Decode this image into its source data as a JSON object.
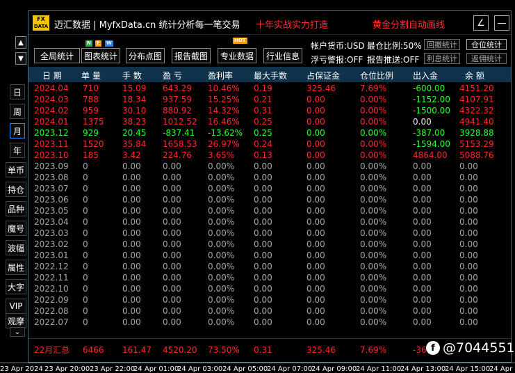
{
  "side": {
    "arrows": [
      "▲",
      "▼"
    ],
    "periods": [
      {
        "label": "日",
        "active": false
      },
      {
        "label": "周",
        "active": false
      },
      {
        "label": "月",
        "active": true
      },
      {
        "label": "年",
        "active": false
      }
    ],
    "functions": [
      "单币",
      "持仓",
      "品种",
      "魔号",
      "波幅",
      "属性",
      "大字",
      "VIP",
      "观摩"
    ],
    "more": "⌄"
  },
  "titlebar": {
    "logo_top": "FX",
    "logo_bottom": "DATA",
    "title": "迈汇数据 | MyfxData.cn  统计分析每一笔交易",
    "slogan1": "十年实战实力打造",
    "slogan2": "黄金分割自动画线",
    "btn_draw": "∠",
    "btn_min": "—"
  },
  "toolbar": {
    "buttons": [
      "全局统计",
      "图表统计",
      "分布点图",
      "报告截图",
      "专业数据",
      "行业信息"
    ],
    "badges": {
      "n": "N",
      "e": "E",
      "w": "W",
      "hot": "HOT"
    },
    "account_currency": "帐户货币:USD",
    "floating_alert": "浮亏警报:OFF",
    "max_ratio": "最仓比例:50%",
    "report_push": "报告推送:OFF",
    "retrace_btn": "回撤统计",
    "interest_btn": "利息统计",
    "position_btn": "仓位统计",
    "commission_btn": "返佣统计"
  },
  "table": {
    "headers": [
      "日 期",
      "单 量",
      "手 数",
      "盈 亏",
      "盈利率",
      "最大手数",
      "占保证金",
      "仓位比例",
      "出入金",
      "余 额"
    ],
    "rows": [
      {
        "color": "red",
        "cells": [
          "2024.04",
          "710",
          "15.09",
          "643.29",
          "10.46%",
          "0.19",
          "325.46",
          "7.69%",
          "-600.00",
          "4151.20"
        ],
        "flow": "green"
      },
      {
        "color": "red",
        "cells": [
          "2024.03",
          "788",
          "18.34",
          "937.59",
          "15.25%",
          "0.21",
          "0.00",
          "0.00%",
          "-1152.00",
          "4107.91"
        ],
        "flow": "green"
      },
      {
        "color": "red",
        "cells": [
          "2024.02",
          "959",
          "30.10",
          "880.92",
          "14.32%",
          "0.31",
          "0.00",
          "0.00%",
          "-1500.00",
          "4322.32"
        ],
        "flow": "green"
      },
      {
        "color": "red",
        "cells": [
          "2024.01",
          "1375",
          "38.23",
          "1012.52",
          "16.46%",
          "0.25",
          "0.00",
          "0.00%",
          "0.00",
          "4941.40"
        ],
        "flow": "white"
      },
      {
        "color": "green",
        "cells": [
          "2023.12",
          "929",
          "20.45",
          "-837.41",
          "-13.62%",
          "0.25",
          "0.00",
          "0.00%",
          "-387.00",
          "3928.88"
        ],
        "flow": "green"
      },
      {
        "color": "red",
        "cells": [
          "2023.11",
          "1520",
          "35.84",
          "1658.53",
          "26.97%",
          "0.24",
          "0.00",
          "0.00%",
          "-1594.00",
          "5153.29"
        ],
        "flow": "green"
      },
      {
        "color": "red",
        "cells": [
          "2023.10",
          "185",
          "3.42",
          "224.76",
          "3.65%",
          "0.13",
          "0.00",
          "0.00%",
          "4864.00",
          "5088.76"
        ],
        "flow": "red"
      },
      {
        "color": "gray",
        "cells": [
          "2023.09",
          "0",
          "0.00",
          "0.00",
          "0.00%",
          "0.00",
          "0.00",
          "0.00%",
          "0.00",
          "0.00"
        ],
        "flow": "gray"
      },
      {
        "color": "gray",
        "cells": [
          "2023.08",
          "0",
          "0.00",
          "0.00",
          "0.00%",
          "0.00",
          "0.00",
          "0.00%",
          "0.00",
          "0.00"
        ],
        "flow": "gray"
      },
      {
        "color": "gray",
        "cells": [
          "2023.07",
          "0",
          "0.00",
          "0.00",
          "0.00%",
          "0.00",
          "0.00",
          "0.00%",
          "0.00",
          "0.00"
        ],
        "flow": "gray"
      },
      {
        "color": "gray",
        "cells": [
          "2023.06",
          "0",
          "0.00",
          "0.00",
          "0.00%",
          "0.00",
          "0.00",
          "0.00%",
          "0.00",
          "0.00"
        ],
        "flow": "gray"
      },
      {
        "color": "gray",
        "cells": [
          "2023.05",
          "0",
          "0.00",
          "0.00",
          "0.00%",
          "0.00",
          "0.00",
          "0.00%",
          "0.00",
          "0.00"
        ],
        "flow": "gray"
      },
      {
        "color": "gray",
        "cells": [
          "2023.04",
          "0",
          "0.00",
          "0.00",
          "0.00%",
          "0.00",
          "0.00",
          "0.00%",
          "0.00",
          "0.00"
        ],
        "flow": "gray"
      },
      {
        "color": "gray",
        "cells": [
          "2023.03",
          "0",
          "0.00",
          "0.00",
          "0.00%",
          "0.00",
          "0.00",
          "0.00%",
          "0.00",
          "0.00"
        ],
        "flow": "gray"
      },
      {
        "color": "gray",
        "cells": [
          "2023.02",
          "0",
          "0.00",
          "0.00",
          "0.00%",
          "0.00",
          "0.00",
          "0.00%",
          "0.00",
          "0.00"
        ],
        "flow": "gray"
      },
      {
        "color": "gray",
        "cells": [
          "2023.01",
          "0",
          "0.00",
          "0.00",
          "0.00%",
          "0.00",
          "0.00",
          "0.00%",
          "0.00",
          "0.00"
        ],
        "flow": "gray"
      },
      {
        "color": "gray",
        "cells": [
          "2022.12",
          "0",
          "0.00",
          "0.00",
          "0.00%",
          "0.00",
          "0.00",
          "0.00%",
          "0.00",
          "0.00"
        ],
        "flow": "gray"
      },
      {
        "color": "gray",
        "cells": [
          "2022.11",
          "0",
          "0.00",
          "0.00",
          "0.00%",
          "0.00",
          "0.00",
          "0.00%",
          "0.00",
          "0.00"
        ],
        "flow": "gray"
      },
      {
        "color": "gray",
        "cells": [
          "2022.10",
          "0",
          "0.00",
          "0.00",
          "0.00%",
          "0.00",
          "0.00",
          "0.00%",
          "0.00",
          "0.00"
        ],
        "flow": "gray"
      },
      {
        "color": "gray",
        "cells": [
          "2022.09",
          "0",
          "0.00",
          "0.00",
          "0.00%",
          "0.00",
          "0.00",
          "0.00%",
          "0.00",
          "0.00"
        ],
        "flow": "gray"
      },
      {
        "color": "gray",
        "cells": [
          "2022.08",
          "0",
          "0.00",
          "0.00",
          "0.00%",
          "0.00",
          "0.00",
          "0.00%",
          "0.00",
          "0.00"
        ],
        "flow": "gray"
      },
      {
        "color": "gray",
        "cells": [
          "2022.07",
          "0",
          "0.00",
          "0.00",
          "0.00%",
          "0.00",
          "0.00",
          "0.00%",
          "0.00",
          "0.00"
        ],
        "flow": "gray"
      }
    ],
    "summary": [
      "22月汇总",
      "6466",
      "161.47",
      "4520.20",
      "73.50%",
      "0.31",
      "325.46",
      "7.69%",
      "-36"
    ]
  },
  "watermark": {
    "icon": "f",
    "text": "@7044551"
  },
  "time_axis": [
    "23 Apr 2024",
    "23 Apr 20:00",
    "23 Apr 22:00",
    "24 Apr 01:00",
    "24 Apr 03:00",
    "24 Apr 05:00",
    "24 Apr 07:00",
    "24 Apr 09:00",
    "24 Apr 11:00",
    "24 Apr 13:00",
    "24 Apr 15:00",
    "24 Apr 1"
  ],
  "colors": {
    "red": "#ff2a2a",
    "green": "#29ff29",
    "gray": "#a8a8a8",
    "header_bg": "#10324a",
    "accent": "#1e90ff",
    "logo": "#f5c400"
  }
}
